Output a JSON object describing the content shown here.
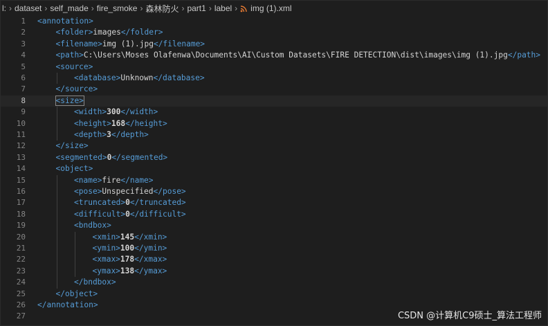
{
  "breadcrumb": {
    "items": [
      "l:",
      "dataset",
      "self_made",
      "fire_smoke",
      "森林防火",
      "part1",
      "label",
      "img (1).xml"
    ],
    "file_icon": "rss-icon"
  },
  "editor": {
    "active_line": 8,
    "lines": [
      {
        "n": "1",
        "text": "<annotation>"
      },
      {
        "n": "2",
        "text": "<folder>images</folder>"
      },
      {
        "n": "3",
        "text": "<filename>img (1).jpg</filename>"
      },
      {
        "n": "4",
        "text": "<path>C:\\Users\\Moses Olafenwa\\Documents\\AI\\Custom Datasets\\FIRE DETECTION\\dist\\images\\img (1).jpg</path>"
      },
      {
        "n": "5",
        "text": "<source>"
      },
      {
        "n": "6",
        "text": "<database>Unknown</database>"
      },
      {
        "n": "7",
        "text": "</source>"
      },
      {
        "n": "8",
        "text": "<size>"
      },
      {
        "n": "9",
        "text": "<width>300</width>"
      },
      {
        "n": "10",
        "text": "<height>168</height>"
      },
      {
        "n": "11",
        "text": "<depth>3</depth>"
      },
      {
        "n": "12",
        "text": "</size>"
      },
      {
        "n": "13",
        "text": "<segmented>0</segmented>"
      },
      {
        "n": "14",
        "text": "<object>"
      },
      {
        "n": "15",
        "text": "<name>fire</name>"
      },
      {
        "n": "16",
        "text": "<pose>Unspecified</pose>"
      },
      {
        "n": "17",
        "text": "<truncated>0</truncated>"
      },
      {
        "n": "18",
        "text": "<difficult>0</difficult>"
      },
      {
        "n": "19",
        "text": "<bndbox>"
      },
      {
        "n": "20",
        "text": "<xmin>145</xmin>"
      },
      {
        "n": "21",
        "text": "<ymin>100</ymin>"
      },
      {
        "n": "22",
        "text": "<xmax>178</xmax>"
      },
      {
        "n": "23",
        "text": "<ymax>138</ymax>"
      },
      {
        "n": "24",
        "text": "</bndbox>"
      },
      {
        "n": "25",
        "text": "</object>"
      },
      {
        "n": "26",
        "text": "</annotation>"
      },
      {
        "n": "27",
        "text": ""
      }
    ]
  },
  "watermark": "CSDN @计算机C9硕士_算法工程师",
  "colors": {
    "background": "#1e1e1e",
    "tag": "#569cd6",
    "text": "#d4d4d4",
    "line_number": "#858585"
  }
}
